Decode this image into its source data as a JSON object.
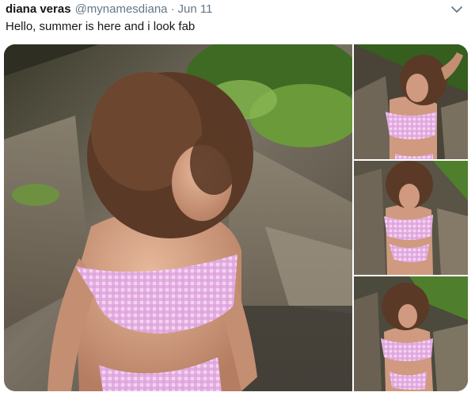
{
  "tweet": {
    "display_name": "diana veras",
    "username": "@mynamesdiana",
    "separator": "·",
    "timestamp": "Jun 11",
    "text": "Hello, summer is here and i look fab",
    "more_icon": "chevron-down-icon",
    "photo_count": 4
  },
  "colors": {
    "text": "#14171a",
    "secondary_text": "#657786",
    "swimsuit": "#e7b7e6",
    "hair": "#5a3a26",
    "skin": "#cf9a7f",
    "rock": "#6f6658",
    "foliage": "#6b9a3a"
  }
}
